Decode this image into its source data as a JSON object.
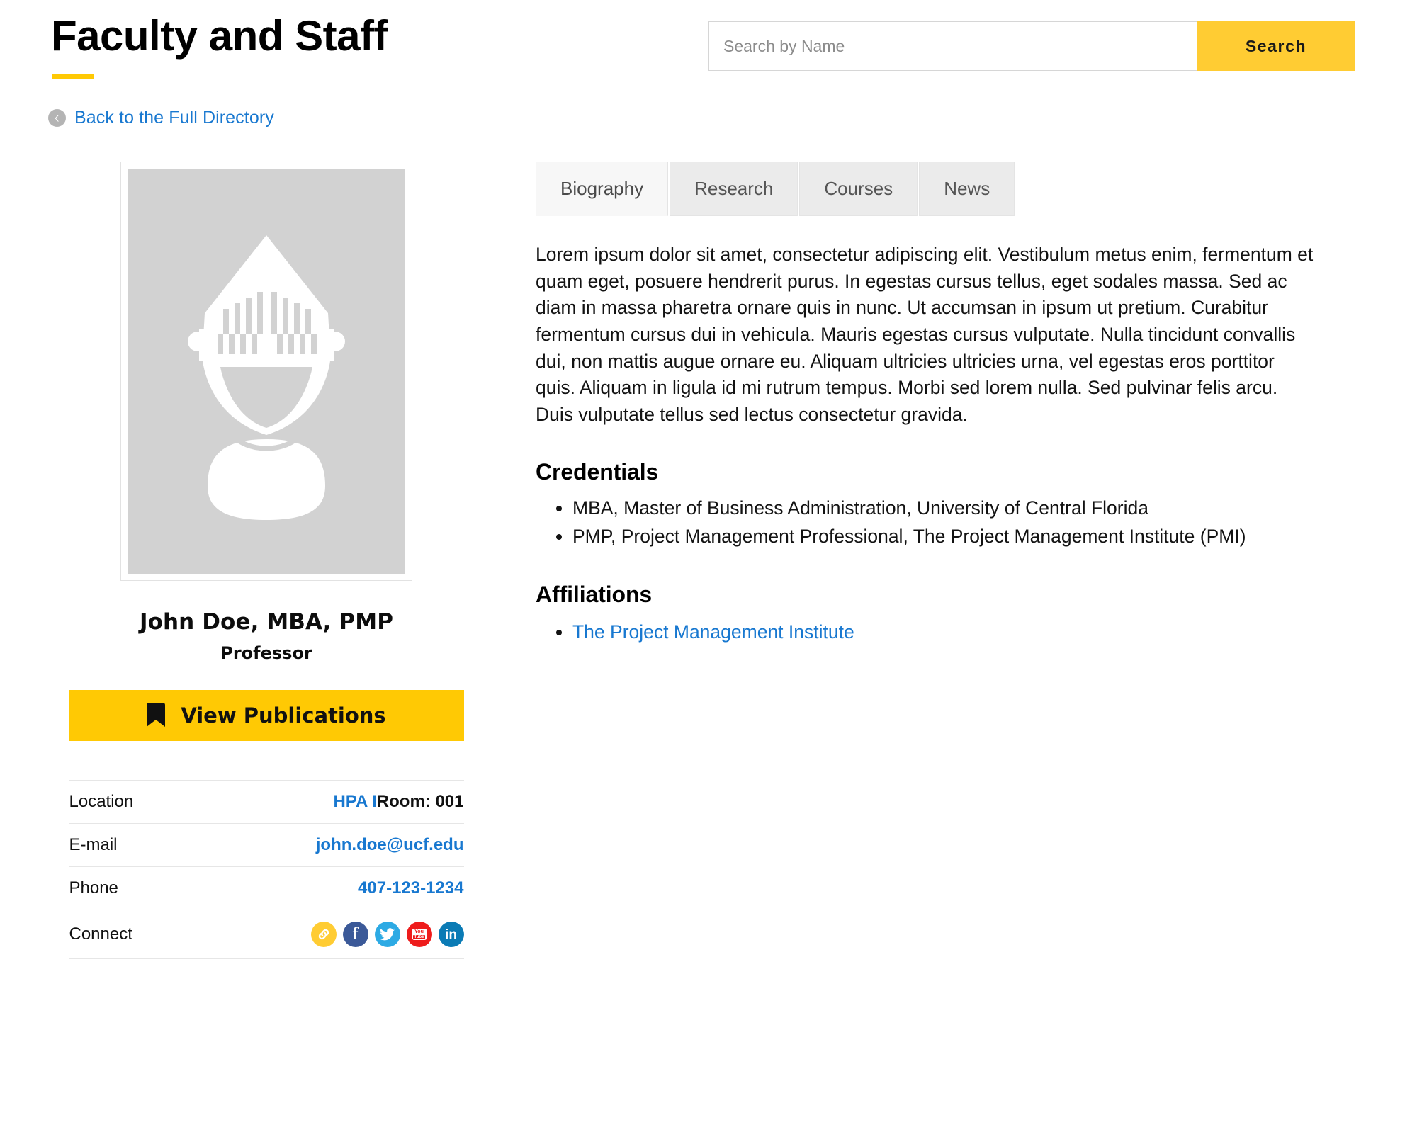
{
  "header": {
    "title": "Faculty and Staff",
    "accent_color": "#FFC904"
  },
  "search": {
    "placeholder": "Search by Name",
    "value": "",
    "button_label": "Search",
    "button_color": "#FFCC33"
  },
  "back_link": {
    "label": "Back to the Full Directory",
    "icon": "chevron-left-circle-icon",
    "color": "#1878d0"
  },
  "profile": {
    "photo_alt": "knight-helmet-placeholder-icon",
    "name": "John Doe, MBA, PMP",
    "title": "Professor",
    "publications_button": {
      "label": "View Publications",
      "icon": "bookmark-icon",
      "color": "#FFC904"
    },
    "contact": [
      {
        "label": "Location",
        "link_text": "HPA I",
        "plain_text": "Room: 001",
        "type": "location"
      },
      {
        "label": "E-mail",
        "link_text": "john.doe@ucf.edu",
        "type": "email"
      },
      {
        "label": "Phone",
        "link_text": "407-123-1234",
        "type": "phone"
      },
      {
        "label": "Connect",
        "type": "social"
      }
    ],
    "social_links": [
      {
        "name": "website-link-icon",
        "color": "#FFCC33"
      },
      {
        "name": "facebook-icon",
        "color": "#3b5998",
        "glyph": "f"
      },
      {
        "name": "twitter-icon",
        "color": "#2daae4"
      },
      {
        "name": "youtube-icon",
        "color": "#ee1c1c",
        "line1": "You",
        "line2": "Tube"
      },
      {
        "name": "linkedin-icon",
        "color": "#0b7bb5",
        "glyph": "in"
      }
    ]
  },
  "tabs": [
    {
      "label": "Biography",
      "active": true
    },
    {
      "label": "Research",
      "active": false
    },
    {
      "label": "Courses",
      "active": false
    },
    {
      "label": "News",
      "active": false
    }
  ],
  "biography": {
    "paragraph": "Lorem ipsum dolor sit amet, consectetur adipiscing elit. Vestibulum metus enim, fermentum et quam eget, posuere hendrerit purus. In egestas cursus tellus, eget sodales massa. Sed ac diam in massa pharetra ornare quis in nunc. Ut accumsan in ipsum ut pretium. Curabitur fermentum cursus dui in vehicula. Mauris egestas cursus vulputate. Nulla tincidunt convallis dui, non mattis augue ornare eu. Aliquam ultricies ultricies urna, vel egestas eros porttitor quis. Aliquam in ligula id mi rutrum tempus. Morbi sed lorem nulla. Sed pulvinar felis arcu. Duis vulputate tellus sed lectus consectetur gravida."
  },
  "credentials": {
    "heading": "Credentials",
    "items": [
      "MBA, Master of Business Administration, University of Central Florida",
      "PMP, Project Management Professional, The Project Management Institute (PMI)"
    ]
  },
  "affiliations": {
    "heading": "Affiliations",
    "items": [
      "The Project Management Institute"
    ]
  }
}
